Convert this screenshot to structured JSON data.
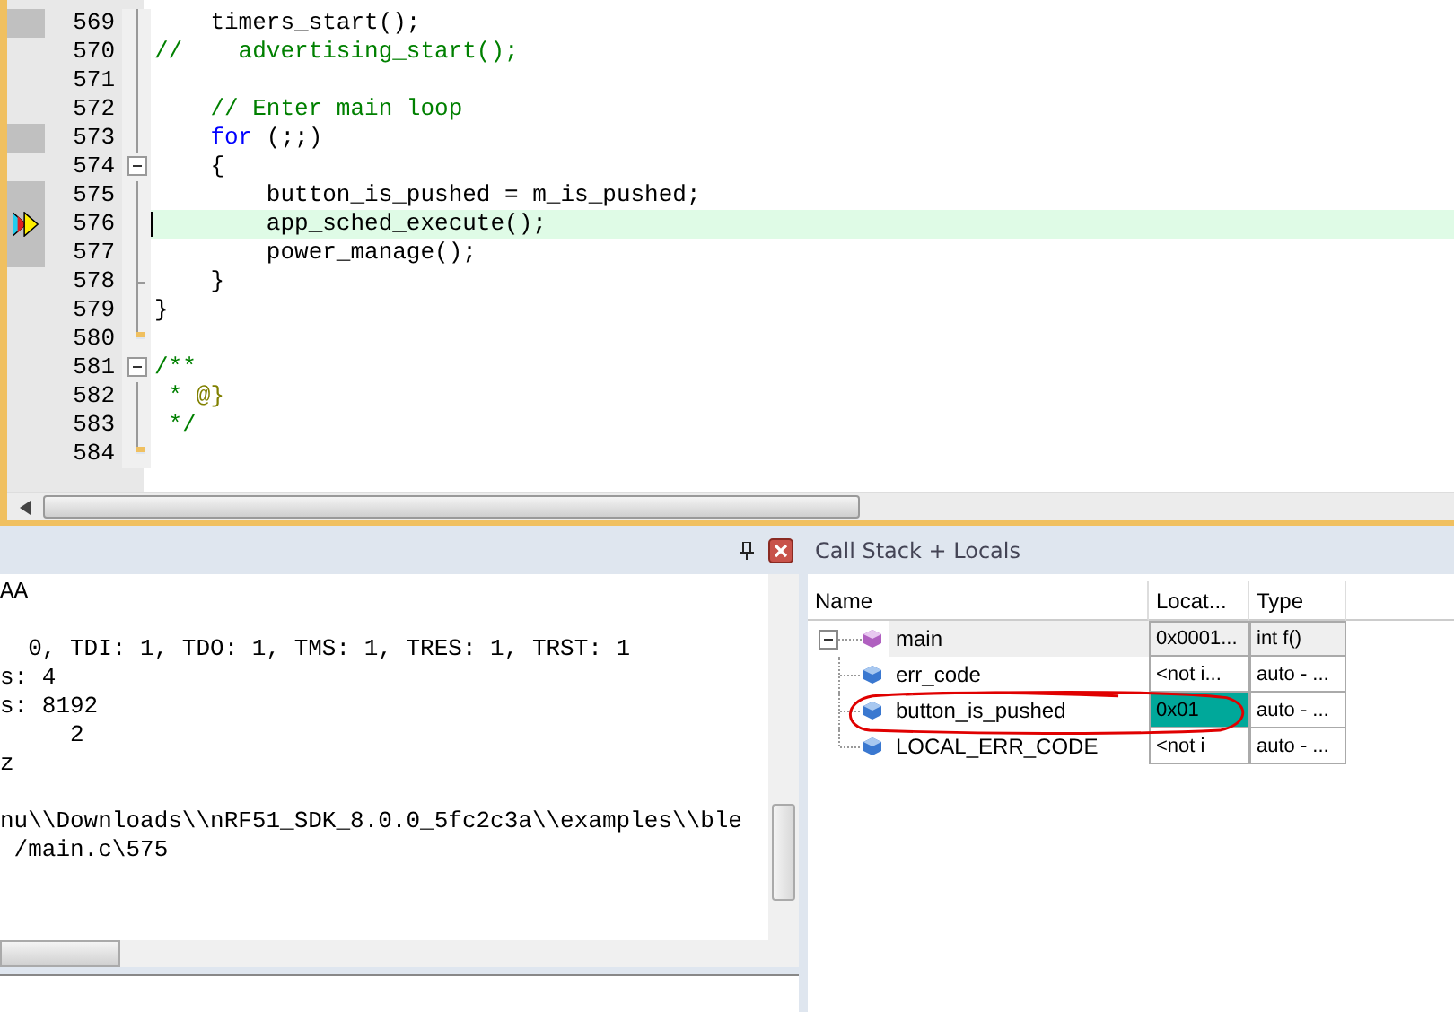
{
  "editor": {
    "lines": [
      {
        "number": "569",
        "marker": true,
        "current": false,
        "kind": "fold_line",
        "segments": [
          {
            "kind": "plain",
            "text": "    timers_start();"
          }
        ]
      },
      {
        "number": "570",
        "marker": false,
        "current": false,
        "kind": "fold_line",
        "segments": [
          {
            "kind": "comment",
            "text": "//    advertising_start();"
          }
        ]
      },
      {
        "number": "571",
        "marker": false,
        "current": false,
        "kind": "fold_line"
      },
      {
        "number": "572",
        "marker": false,
        "current": false,
        "kind": "fold_line",
        "segments": [
          {
            "kind": "comment",
            "text": "    // Enter main loop"
          }
        ]
      },
      {
        "number": "573",
        "marker": true,
        "current": false,
        "kind": "fold_line",
        "segments": [
          {
            "kind": "keyword",
            "text": "    for"
          },
          {
            "kind": "plain",
            "text": " (;;)"
          }
        ]
      },
      {
        "number": "574",
        "marker": false,
        "current": false,
        "kind": "fold_start",
        "segments": [
          {
            "kind": "plain",
            "text": "    {"
          }
        ]
      },
      {
        "number": "575",
        "marker": true,
        "current": false,
        "kind": "fold_line",
        "segments": [
          {
            "kind": "plain",
            "text": "        button_is_pushed = m_is_pushed;"
          }
        ]
      },
      {
        "number": "576",
        "marker": true,
        "current": true,
        "kind": "fold_line",
        "segments": [
          {
            "kind": "plain",
            "text": "        app_sched_execute();"
          }
        ]
      },
      {
        "number": "577",
        "marker": true,
        "current": false,
        "kind": "fold_line",
        "segments": [
          {
            "kind": "plain",
            "text": "        power_manage();"
          }
        ]
      },
      {
        "number": "578",
        "marker": false,
        "current": false,
        "kind": "fold_tick",
        "segments": [
          {
            "kind": "plain",
            "text": "    }"
          }
        ]
      },
      {
        "number": "579",
        "marker": false,
        "current": false,
        "kind": "fold_line",
        "segments": [
          {
            "kind": "plain",
            "text": "}"
          }
        ]
      },
      {
        "number": "580",
        "marker": false,
        "current": false,
        "kind": "fold_end"
      },
      {
        "number": "581",
        "marker": false,
        "current": false,
        "kind": "fold_start",
        "segments": [
          {
            "kind": "comment",
            "text": "/**"
          }
        ]
      },
      {
        "number": "582",
        "marker": false,
        "current": false,
        "kind": "fold_line",
        "segments": [
          {
            "kind": "comment",
            "text": " * "
          },
          {
            "kind": "tag",
            "text": "@}"
          }
        ]
      },
      {
        "number": "583",
        "marker": false,
        "current": false,
        "kind": "fold_line",
        "segments": [
          {
            "kind": "comment",
            "text": " */"
          }
        ]
      },
      {
        "number": "584",
        "marker": false,
        "current": false,
        "kind": "fold_end"
      }
    ]
  },
  "output": {
    "blocks": [
      [
        "AA"
      ],
      [
        "  0, TDI: 1, TDO: 1, TMS: 1, TRES: 1, TRST: 1",
        "s: 4",
        "s: 8192",
        "     2",
        "z"
      ],
      [
        "nu\\\\Downloads\\\\nRF51_SDK_8.0.0_5fc2c3a\\\\examples\\\\ble",
        " /main.c\\575"
      ]
    ]
  },
  "locals": {
    "title": "Call Stack + Locals",
    "columns": [
      "Name",
      "Locat...",
      "Type"
    ],
    "rows": [
      {
        "kind": "function",
        "name": "main",
        "location": "0x0001...",
        "type": "int f()",
        "expanded": true,
        "changed": false,
        "children": [
          {
            "kind": "variable",
            "name": "err_code",
            "location": "<not i...",
            "type": "auto - ...",
            "changed": false
          },
          {
            "kind": "variable",
            "name": "button_is_pushed",
            "location": "0x01",
            "type": "auto - ...",
            "changed": true
          },
          {
            "kind": "variable",
            "name": "LOCAL_ERR_CODE",
            "location": "<not i",
            "type": "auto - ...",
            "changed": false
          }
        ]
      }
    ]
  }
}
